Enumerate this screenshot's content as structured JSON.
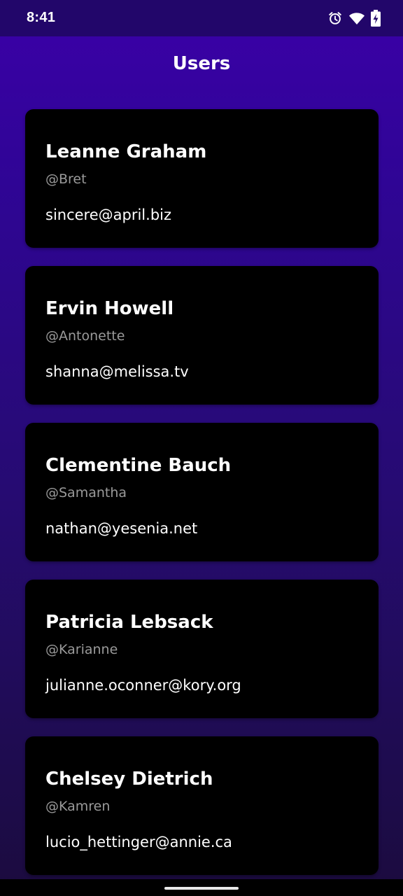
{
  "status_bar": {
    "time": "8:41",
    "icons": [
      "alarm-icon",
      "wifi-icon",
      "battery-charging-icon"
    ]
  },
  "header": {
    "title": "Users"
  },
  "users": [
    {
      "name": "Leanne Graham",
      "username": "@Bret",
      "email": "sincere@april.biz"
    },
    {
      "name": "Ervin Howell",
      "username": "@Antonette",
      "email": "shanna@melissa.tv"
    },
    {
      "name": "Clementine Bauch",
      "username": "@Samantha",
      "email": "nathan@yesenia.net"
    },
    {
      "name": "Patricia Lebsack",
      "username": "@Karianne",
      "email": "julianne.oconner@kory.org"
    },
    {
      "name": "Chelsey Dietrich",
      "username": "@Kamren",
      "email": "lucio_hettinger@annie.ca"
    }
  ],
  "colors": {
    "background_top": "#3b00a8",
    "background_bottom": "#1b0b3e",
    "card": "#000000",
    "username_text": "#9a9a9a"
  }
}
